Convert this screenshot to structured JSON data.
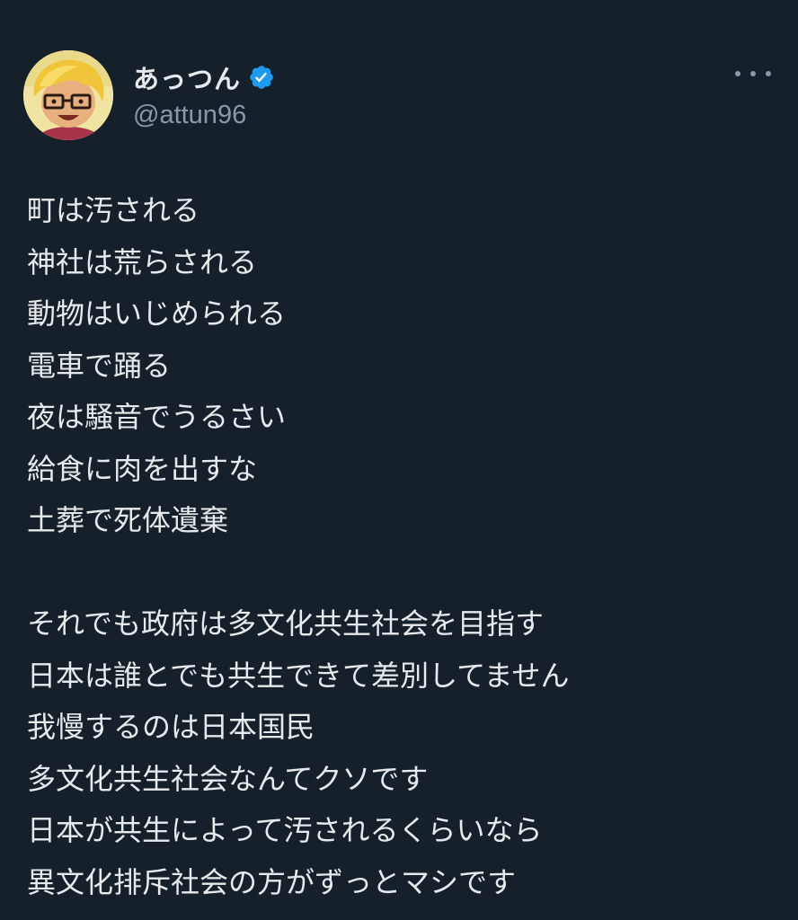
{
  "tweet": {
    "author": {
      "display_name": "あっつん",
      "handle": "@attun96",
      "verified": true,
      "verified_color": "#1d9bf0"
    },
    "more_icon": "more-horizontal-icon",
    "lines_block1": [
      "町は汚される",
      "神社は荒らされる",
      "動物はいじめられる",
      "電車で踊る",
      "夜は騒音でうるさい",
      "給食に肉を出すな",
      "土葬で死体遺棄"
    ],
    "lines_block2": [
      "それでも政府は多文化共生社会を目指す",
      "日本は誰とでも共生できて差別してません",
      "我慢するのは日本国民",
      "多文化共生社会なんてクソです",
      "日本が共生によって汚されるくらいなら",
      "異文化排斥社会の方がずっとマシです"
    ]
  },
  "colors": {
    "background": "#15202b",
    "text_primary": "#e7e9ea",
    "text_secondary": "#8b98a5"
  }
}
